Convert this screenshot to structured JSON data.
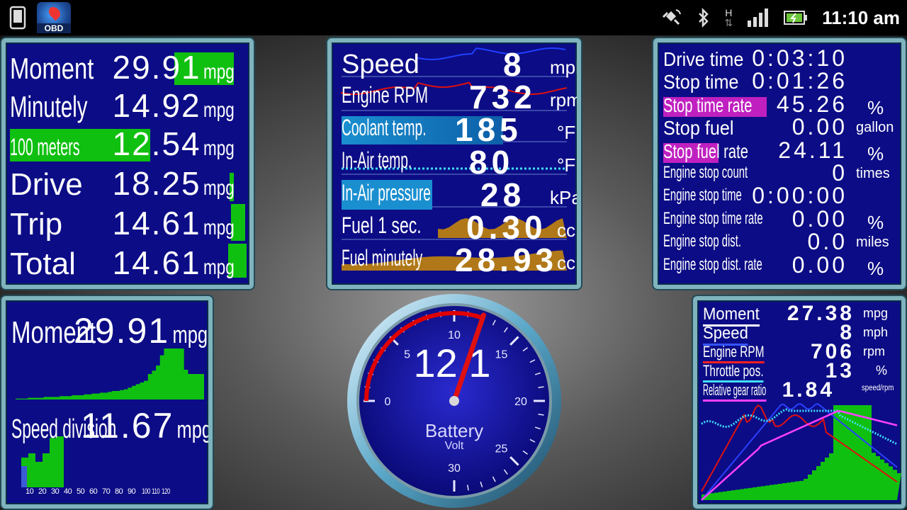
{
  "status_bar": {
    "app_logo_text": "OBD",
    "clock": "11:10 am",
    "network_type": "H",
    "icons": [
      "phone-icon",
      "obd-app-icon",
      "gps-icon",
      "bluetooth-icon",
      "network-h-icon",
      "signal-icon",
      "battery-charging-icon"
    ]
  },
  "fuel_panel": {
    "rows": [
      {
        "label": "Moment",
        "value": "29.91",
        "unit": "mpg",
        "level": 0.28
      },
      {
        "label": "Minutely",
        "value": "14.92",
        "unit": "mpg",
        "level": 0.0
      },
      {
        "label": "100 meters",
        "value": "12.54",
        "unit": "mpg",
        "level": 0.62
      },
      {
        "label": "Drive",
        "value": "18.25",
        "unit": "mpg",
        "level": 0.0
      },
      {
        "label": "Trip",
        "value": "14.61",
        "unit": "mpg",
        "level": 0.0
      },
      {
        "label": "Total",
        "value": "14.61",
        "unit": "mpg",
        "level": 0.0
      }
    ]
  },
  "engine_panel": {
    "rows": [
      {
        "label": "Speed",
        "value": "8",
        "unit": "mph"
      },
      {
        "label": "Engine RPM",
        "value": "732",
        "unit": "rpm"
      },
      {
        "label": "Coolant temp.",
        "value": "185",
        "unit": "°F"
      },
      {
        "label": "In-Air temp.",
        "value": "80",
        "unit": "°F"
      },
      {
        "label": "In-Air pressure",
        "value": "28",
        "unit": "kPa"
      },
      {
        "label": "Fuel 1 sec.",
        "value": "0.30",
        "unit": "cc"
      },
      {
        "label": "Fuel minutely",
        "value": "28.93",
        "unit": "cc"
      }
    ]
  },
  "stop_panel": {
    "rows": [
      {
        "label": "Drive time",
        "value": "0:03:10",
        "unit": ""
      },
      {
        "label": "Stop time",
        "value": "0:01:26",
        "unit": ""
      },
      {
        "label": "Stop time rate",
        "value": "45.26",
        "unit": "%"
      },
      {
        "label": "Stop fuel",
        "value": "0.00",
        "unit": "gallon"
      },
      {
        "label": "Stop fuel rate",
        "value": "24.11",
        "unit": "%"
      },
      {
        "label": "Engine stop count",
        "value": "0",
        "unit": "times"
      },
      {
        "label": "Engine stop time",
        "value": "0:00:00",
        "unit": ""
      },
      {
        "label": "Engine stop time rate",
        "value": "0.00",
        "unit": "%"
      },
      {
        "label": "Engine stop dist.",
        "value": "0.0",
        "unit": "miles"
      },
      {
        "label": "Engine stop dist. rate",
        "value": "0.00",
        "unit": "%"
      }
    ]
  },
  "moment_panel": {
    "top": {
      "label": "Moment",
      "value": "29.91",
      "unit": "mpg"
    },
    "bottom": {
      "label": "Speed division",
      "value": "11.67",
      "unit": "mpg"
    },
    "speed_ticks": [
      "10",
      "20",
      "30",
      "40",
      "50",
      "60",
      "70",
      "80",
      "90",
      "100",
      "110",
      "120"
    ],
    "moment_history": [
      1,
      1,
      1,
      2,
      2,
      2,
      2,
      3,
      3,
      3,
      3,
      4,
      4,
      4,
      5,
      5,
      5,
      6,
      6,
      7,
      7,
      8,
      8,
      9,
      10,
      10,
      11,
      12,
      14,
      16,
      18,
      20,
      22,
      30,
      34,
      40,
      52,
      60,
      60,
      60,
      60,
      60,
      35,
      30,
      30,
      30,
      30
    ],
    "speed_division_bars": [
      35,
      40,
      30,
      40,
      58,
      60
    ]
  },
  "battery_gauge": {
    "value": "12.1",
    "label": "Battery",
    "unit": "Volt",
    "ticks": [
      "0",
      "5",
      "10",
      "15",
      "20",
      "25",
      "30"
    ],
    "min": 0,
    "max": 30,
    "reading": 12.1
  },
  "live_panel": {
    "rows": [
      {
        "label": "Moment",
        "value": "27.38",
        "unit": "mpg",
        "color": "#ffffff"
      },
      {
        "label": "Speed",
        "value": "8",
        "unit": "mph",
        "color": "#3355ff"
      },
      {
        "label": "Engine RPM",
        "value": "706",
        "unit": "rpm",
        "color": "#ff2020"
      },
      {
        "label": "Throttle pos.",
        "value": "13",
        "unit": "%",
        "color": "#40e0ff"
      },
      {
        "label": "Relative gear ratio",
        "value": "1.84",
        "unit": "speed/rpm",
        "color": "#ff40ff"
      }
    ]
  },
  "colors": {
    "panel_bg": "#0c0c86",
    "panel_border": "#7fb3bd",
    "bar_green": "#10c010",
    "coolant_blue": "#1a8fd0",
    "magenta_bar": "#c020c0",
    "fuel_brown": "#b07818"
  }
}
